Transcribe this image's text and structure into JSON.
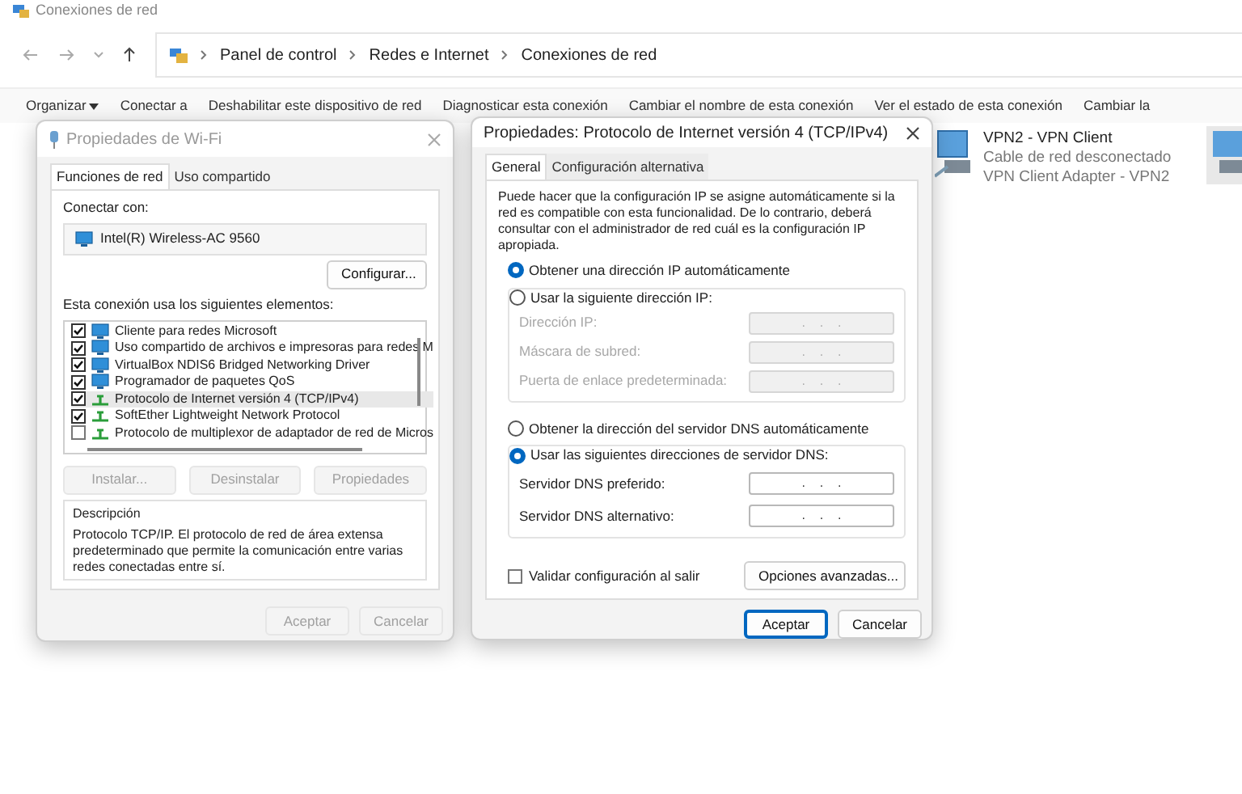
{
  "window": {
    "title": "Conexiones de red"
  },
  "breadcrumb": [
    "Panel de control",
    "Redes e Internet",
    "Conexiones de red"
  ],
  "toolbar": [
    {
      "label": "Organizar",
      "kind": "menu"
    },
    {
      "label": "Conectar a",
      "kind": "command"
    },
    {
      "label": "Deshabilitar este dispositivo de red",
      "kind": "command"
    },
    {
      "label": "Diagnosticar esta conexión",
      "kind": "command"
    },
    {
      "label": "Cambiar el nombre de esta conexión",
      "kind": "command"
    },
    {
      "label": "Ver el estado de esta conexión",
      "kind": "command"
    },
    {
      "label": "Cambiar la",
      "kind": "command"
    }
  ],
  "connections": [
    {
      "name": "VPN2 - VPN Client",
      "status": "Cable de red desconectado",
      "device": "VPN Client Adapter - VPN2"
    }
  ],
  "wifi_dialog": {
    "title": "Propiedades de Wi-Fi",
    "tabs": [
      {
        "label": "Funciones de red",
        "selected": true
      },
      {
        "label": "Uso compartido",
        "selected": false
      }
    ],
    "connect_label": "Conectar con:",
    "adapter": "Intel(R) Wireless-AC 9560",
    "configure_button": "Configurar...",
    "items_label": "Esta conexión usa los siguientes elementos:",
    "items": [
      {
        "label": "Cliente para redes Microsoft",
        "checked": true,
        "selected": false,
        "kind": "service"
      },
      {
        "label": "Uso compartido de archivos e impresoras para redes M",
        "checked": true,
        "selected": false,
        "kind": "service"
      },
      {
        "label": "VirtualBox NDIS6 Bridged Networking Driver",
        "checked": true,
        "selected": false,
        "kind": "service"
      },
      {
        "label": "Programador de paquetes QoS",
        "checked": true,
        "selected": false,
        "kind": "service"
      },
      {
        "label": "Protocolo de Internet versión 4 (TCP/IPv4)",
        "checked": true,
        "selected": true,
        "kind": "protocol"
      },
      {
        "label": "SoftEther Lightweight Network Protocol",
        "checked": true,
        "selected": false,
        "kind": "protocol"
      },
      {
        "label": "Protocolo de multiplexor de adaptador de red de Micros",
        "checked": false,
        "selected": false,
        "kind": "protocol"
      }
    ],
    "item_buttons": [
      {
        "label": "Instalar...",
        "disabled": true
      },
      {
        "label": "Desinstalar",
        "disabled": true
      },
      {
        "label": "Propiedades",
        "disabled": true
      }
    ],
    "description_label": "Descripción",
    "description": "Protocolo TCP/IP. El protocolo de red de área extensa predeterminado que permite la comunicación entre varias redes conectadas entre sí.",
    "buttons": [
      {
        "label": "Aceptar",
        "disabled": true
      },
      {
        "label": "Cancelar",
        "disabled": true
      }
    ]
  },
  "ipv4_dialog": {
    "title": "Propiedades: Protocolo de Internet versión 4 (TCP/IPv4)",
    "tabs": [
      {
        "label": "General",
        "selected": true
      },
      {
        "label": "Configuración alternativa",
        "selected": false
      }
    ],
    "intro": "Puede hacer que la configuración IP se asigne automáticamente si la red es compatible con esta funcionalidad. De lo contrario, deberá consultar con el administrador de red cuál es la configuración IP apropiada.",
    "ip_options": [
      {
        "label": "Obtener una dirección IP automáticamente",
        "selected": true
      },
      {
        "label": "Usar la siguiente dirección IP:",
        "selected": false
      }
    ],
    "ip_fields": [
      {
        "label": "Dirección IP:",
        "value": ".    .    .",
        "disabled": true
      },
      {
        "label": "Máscara de subred:",
        "value": ".    .    .",
        "disabled": true
      },
      {
        "label": "Puerta de enlace predeterminada:",
        "value": ".    .    .",
        "disabled": true
      }
    ],
    "dns_options": [
      {
        "label": "Obtener la dirección del servidor DNS automáticamente",
        "selected": false
      },
      {
        "label": "Usar las siguientes direcciones de servidor DNS:",
        "selected": true
      }
    ],
    "dns_fields": [
      {
        "label": "Servidor DNS preferido:",
        "value": ".    .    .",
        "disabled": false
      },
      {
        "label": "Servidor DNS alternativo:",
        "value": ".    .    .",
        "disabled": false
      }
    ],
    "validate": {
      "label": "Validar configuración al salir",
      "checked": false
    },
    "advanced_button": "Opciones avanzadas...",
    "buttons": [
      {
        "label": "Aceptar",
        "default": true
      },
      {
        "label": "Cancelar",
        "default": false
      }
    ]
  }
}
